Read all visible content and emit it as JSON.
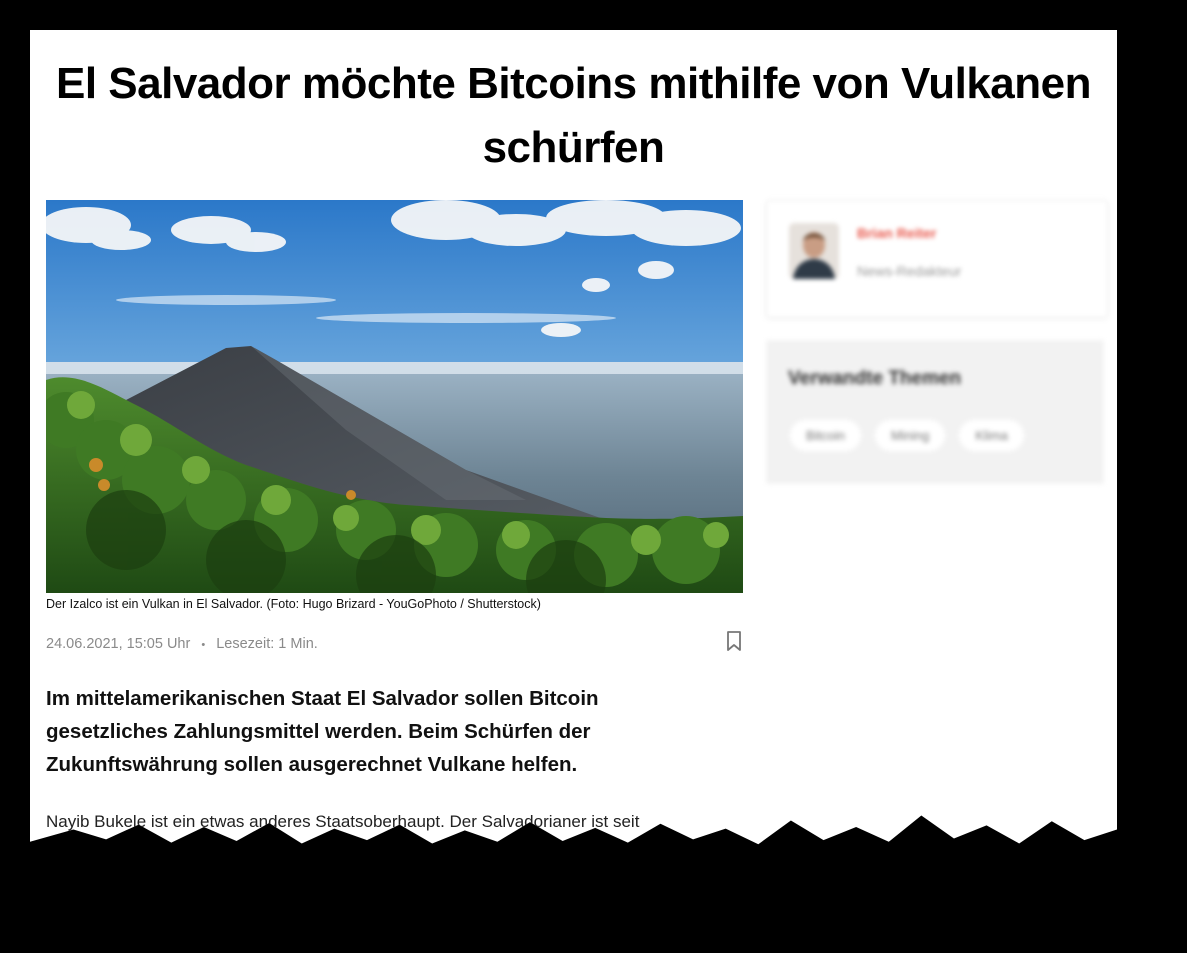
{
  "article": {
    "title": "El Salvador möchte Bitcoins mithilfe von Vulkanen schürfen",
    "image_caption": "Der Izalco ist ein Vulkan in El Salvador. (Foto: Hugo Brizard - YouGoPhoto / Shutterstock)",
    "date": "24.06.2021, 15:05 Uhr",
    "separator": "•",
    "reading_time": "Lesezeit: 1 Min.",
    "lead": "Im mittelamerikanischen Staat El Salvador sollen Bitcoin gesetzliches Zahlungsmittel werden. Beim Schürfen der Zukunftswährung sollen ausgerechnet Vulkane helfen.",
    "body_first_line": "Nayib Bukele ist ein etwas anderes Staatsoberhaupt. Der Salvadorianer ist seit"
  },
  "sidebar": {
    "author_name": "Brian Reiter",
    "author_role": "News-Redakteur",
    "topics_title": "Verwandte Themen",
    "tags": [
      "Bitcoin",
      "Mining",
      "Klima"
    ]
  },
  "icons": {
    "bookmark": "bookmark-icon"
  },
  "colors": {
    "author_accent": "#e8584c",
    "meta_gray": "#8a8a8a"
  }
}
